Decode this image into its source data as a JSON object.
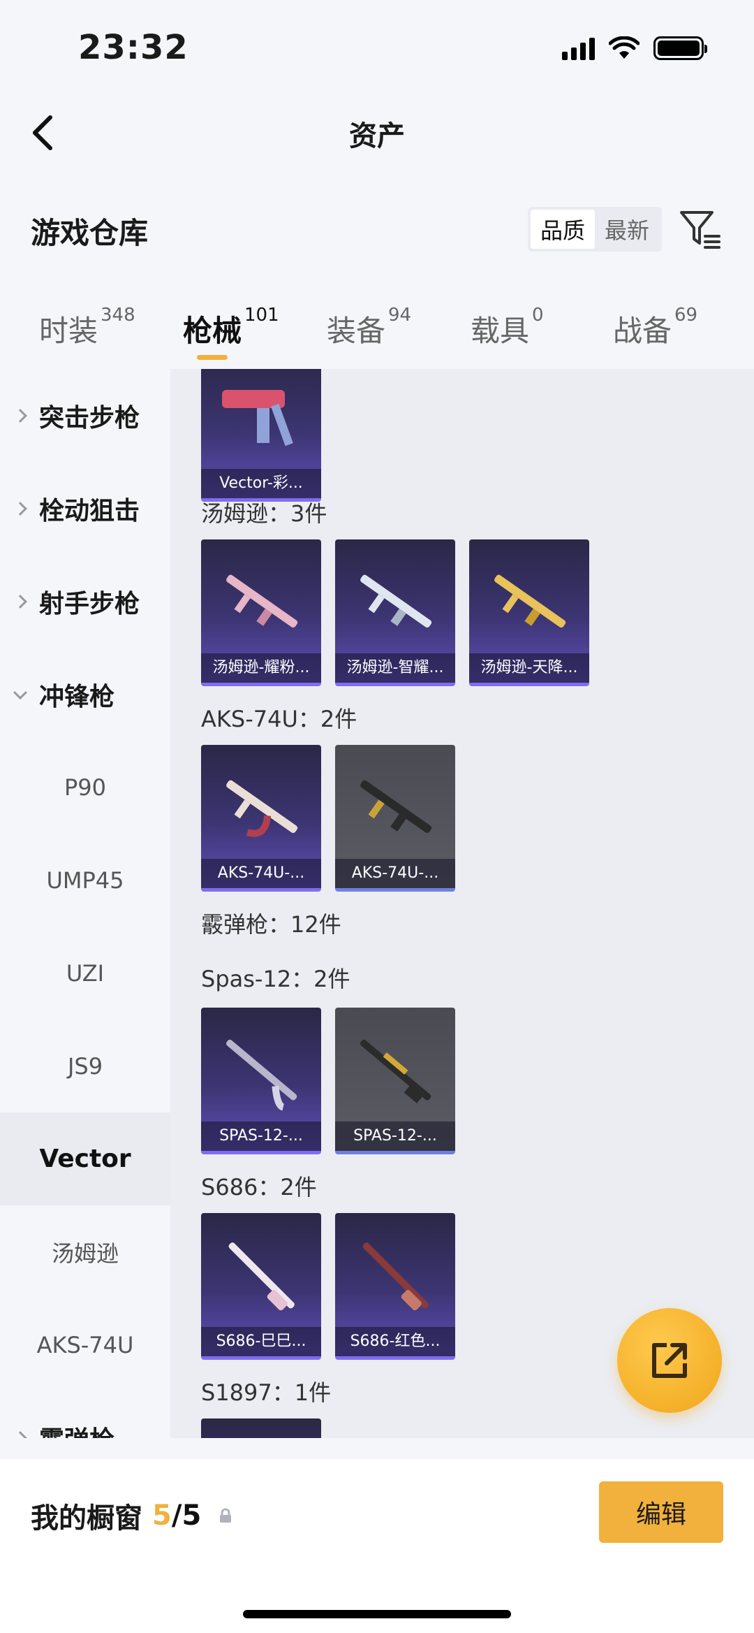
{
  "status": {
    "time": "23:32"
  },
  "nav": {
    "title": "资产"
  },
  "warehouse": {
    "title": "游戏仓库",
    "sort_quality": "品质",
    "sort_latest": "最新"
  },
  "tabs": [
    {
      "label": "时装",
      "count": "348"
    },
    {
      "label": "枪械",
      "count": "101"
    },
    {
      "label": "装备",
      "count": "94"
    },
    {
      "label": "载具",
      "count": "0"
    },
    {
      "label": "战备",
      "count": "69"
    }
  ],
  "sidebar": {
    "items": [
      {
        "label": "突击步枪"
      },
      {
        "label": "栓动狙击"
      },
      {
        "label": "射手步枪"
      },
      {
        "label": "冲锋枪"
      },
      {
        "label": "P90"
      },
      {
        "label": "UMP45"
      },
      {
        "label": "UZI"
      },
      {
        "label": "JS9"
      },
      {
        "label": "Vector"
      },
      {
        "label": "汤姆逊"
      },
      {
        "label": "AKS-74U"
      },
      {
        "label": "霰弹枪"
      }
    ]
  },
  "content": {
    "top_card": "Vector-彩...",
    "groups": [
      {
        "title": "汤姆逊：3件",
        "cards": [
          "汤姆逊-耀粉...",
          "汤姆逊-智耀...",
          "汤姆逊-天降..."
        ]
      },
      {
        "title": "AKS-74U：2件",
        "cards": [
          "AKS-74U-...",
          "AKS-74U-..."
        ]
      },
      {
        "title": "霰弹枪：12件",
        "cards": []
      },
      {
        "title": "Spas-12：2件",
        "cards": [
          "SPAS-12-...",
          "SPAS-12-..."
        ]
      },
      {
        "title": "S686：2件",
        "cards": [
          "S686-巳巳...",
          "S686-红色..."
        ]
      },
      {
        "title": "S1897：1件",
        "cards": []
      }
    ]
  },
  "bottom": {
    "showcase_label": "我的橱窗",
    "showcase_current": "5",
    "showcase_sep": "/",
    "showcase_max": "5",
    "edit_label": "编辑"
  },
  "colors": {
    "accent": "#f2b13c",
    "card_purple": "#3c3573",
    "card_gray": "#55565d"
  }
}
